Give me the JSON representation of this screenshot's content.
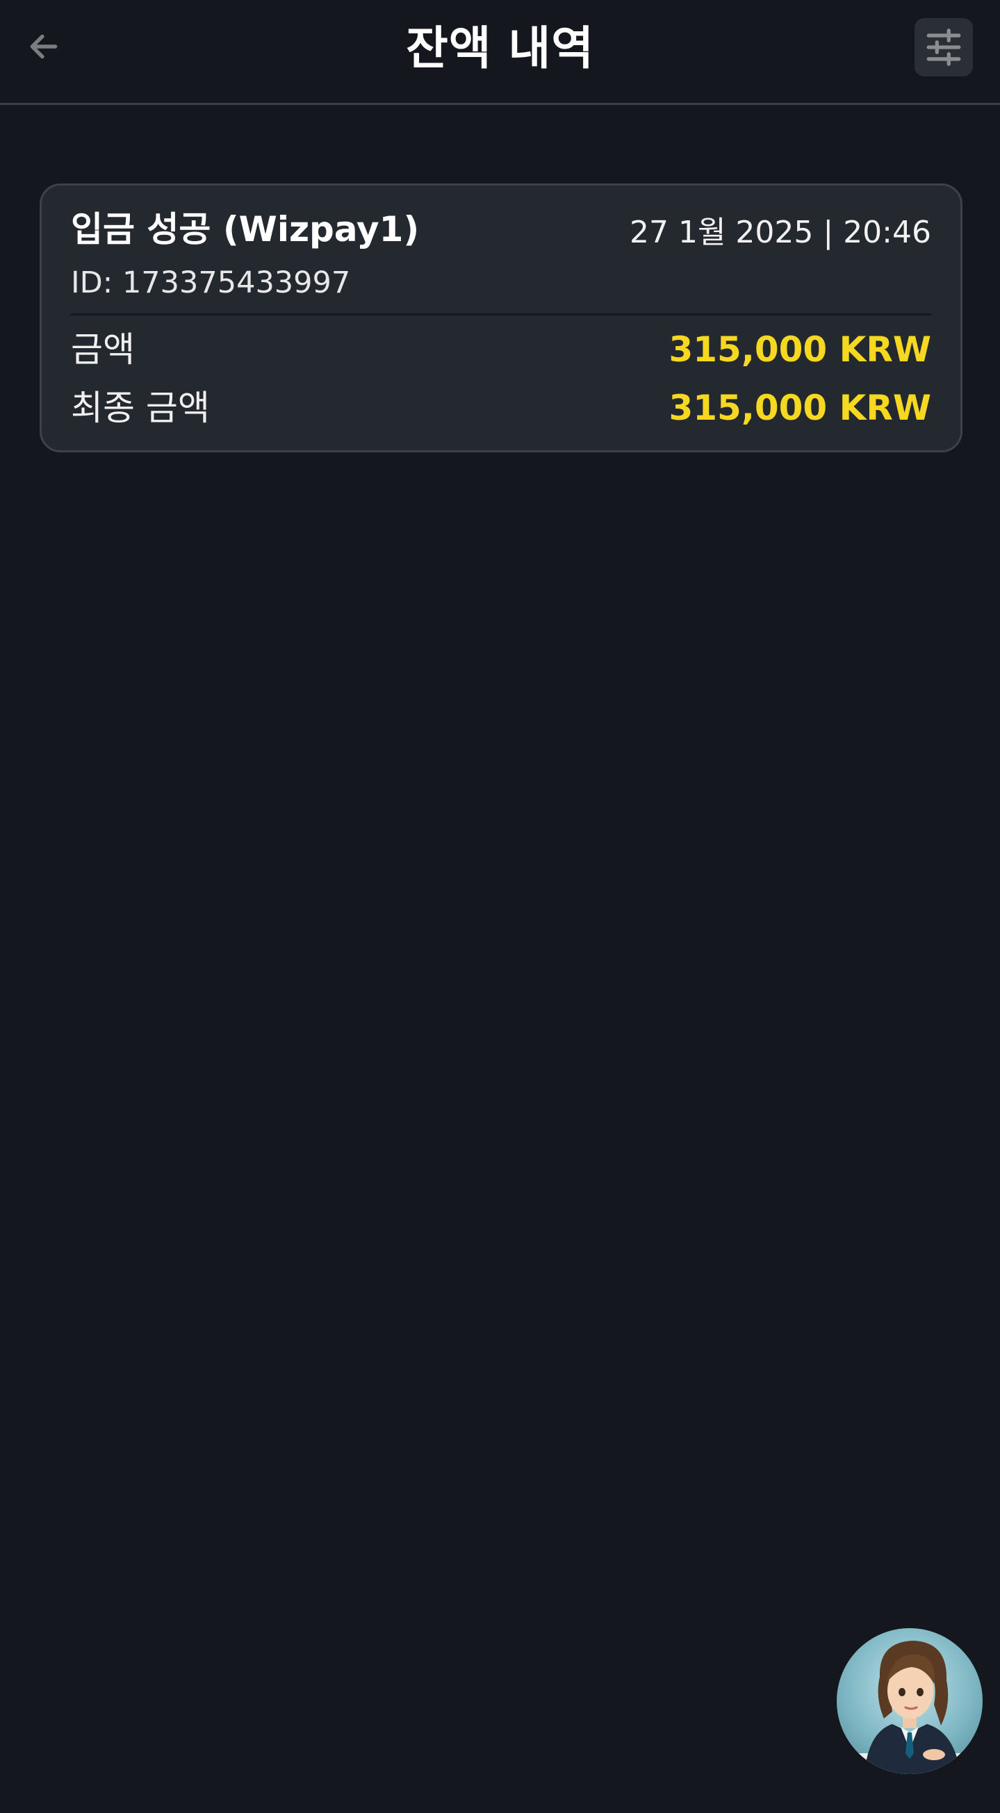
{
  "header": {
    "title": "잔액 내역",
    "back_icon": "arrow-left-icon",
    "filter_icon": "sliders-icon"
  },
  "transactions": [
    {
      "title": "입금 성공 (Wizpay1)",
      "date": "27 1월 2025 | 20:46",
      "id_text": "ID: 173375433997",
      "amount_label": "금액",
      "amount_value": "315,000 KRW",
      "final_label": "최종 금액",
      "final_value": "315,000 KRW"
    }
  ],
  "colors": {
    "background": "#14181e",
    "card": "#24282f",
    "accent_amount": "#f5d81f",
    "icon_muted": "#7a7d82"
  },
  "assistant": {
    "icon": "assistant-avatar-icon"
  }
}
